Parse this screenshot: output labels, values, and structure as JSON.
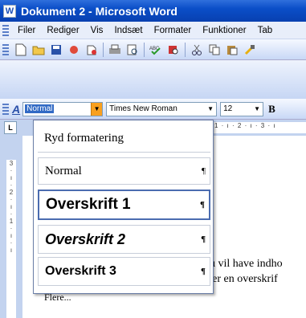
{
  "window": {
    "title": "Dokument 2 - Microsoft Word",
    "app_icon": "word-app-icon"
  },
  "menu": [
    "Filer",
    "Rediger",
    "Vis",
    "Indsæt",
    "Formater",
    "Funktioner",
    "Tab"
  ],
  "toolbar_icons": [
    "new-document-icon",
    "open-folder-icon",
    "save-icon",
    "permission-icon",
    "email-icon",
    "print-icon",
    "print-preview-icon",
    "spelling-icon",
    "research-icon",
    "cut-icon",
    "copy-icon",
    "paste-icon",
    "format-painter-icon"
  ],
  "format_bar": {
    "style_value": "Normal",
    "font_value": "Times New Roman",
    "size_value": "12",
    "bold_label": "B"
  },
  "ruler": {
    "tab_label": "L",
    "marks": "1 · ı · 2 · ı · 3 · ı"
  },
  "style_dropdown": {
    "items": [
      {
        "label": "Ryd formatering",
        "mark": ""
      },
      {
        "label": "Normal",
        "mark": "¶"
      },
      {
        "label": "Overskrift 1",
        "mark": "¶"
      },
      {
        "label": "Overskrift 2",
        "mark": "¶"
      },
      {
        "label": "Overskrift 3",
        "mark": "¶"
      },
      {
        "label": "Flere...",
        "mark": ""
      }
    ]
  },
  "document": {
    "line1": "du vil have indho",
    "line2": "vær en overskrif"
  },
  "colors": {
    "titlebar": "#0a4ec8",
    "dropdown_button": "#f9a020",
    "selection": "#316ac5"
  }
}
